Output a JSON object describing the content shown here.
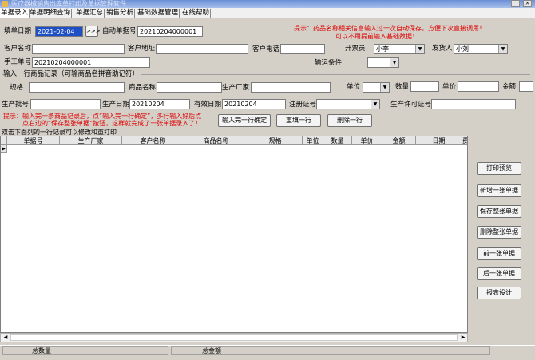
{
  "window": {
    "title": "医疗器械销售出库单打印及单据管理软件",
    "minimize": "_",
    "close": "×"
  },
  "menu": [
    {
      "label": "单据录入",
      "active": true
    },
    {
      "label": "单据明细查询",
      "active": false
    },
    {
      "label": "单据汇总",
      "active": false
    },
    {
      "label": "销售分析",
      "active": false
    },
    {
      "label": "基础数据管理",
      "active": false
    },
    {
      "label": "在线帮助",
      "active": false
    }
  ],
  "form": {
    "fill_date_label": "填单日期",
    "fill_date_value": "2021-02-04",
    "go_button": ">>>",
    "auto_no_label": "自动单据号",
    "auto_no_value": "20210204000001",
    "tip_top_line1": "提示：药品名称相关信息输入过一次自动保存，方便下次直接调用！",
    "tip_top_line2": "可以不用提前输入基础数据！",
    "customer_name_label": "客户名称",
    "customer_name_value": "",
    "customer_addr_label": "客户地址",
    "customer_addr_value": "",
    "customer_phone_label": "客户电话",
    "customer_phone_value": "",
    "issuer_label": "开票员",
    "issuer_value": "小李",
    "shipper_label": "发货人",
    "shipper_value": "小刘",
    "manual_no_label": "手工单号",
    "manual_no_value": "20210204000001",
    "transport_label": "输运条件",
    "transport_value": ""
  },
  "item": {
    "section_title": "输入一行商品记录（可输商品名拼音助记符）",
    "spec_label": "规格",
    "name_label": "商品名称",
    "maker_label": "生产厂家",
    "unit_label": "单位",
    "qty_label": "数量",
    "price_label": "单价",
    "amount_label": "金额",
    "batch_label": "生产批号",
    "prod_date_label": "生产日期",
    "prod_date_value": "20210204",
    "expiry_label": "有效日期",
    "expiry_value": "20210204",
    "reg_label": "注册证号",
    "license_label": "生产许可证号",
    "tip_line1": "提示：输入完一条商品记录后，点“输入完一行确定”，多行输入好后点",
    "tip_line2": "点右边的“保存整张单据”按钮，这样就完成了一张单据录入了！",
    "confirm_button": "输入完一行确定",
    "refill_button": "重填一行",
    "delete_row_button": "删除一行"
  },
  "grid": {
    "hint": "双击下面列的一行记录可以修改和重打印",
    "columns": [
      "单据号",
      "生产厂家",
      "客户名称",
      "商品名称",
      "规格",
      "单位",
      "数量",
      "单价",
      "金额",
      "日期",
      "费"
    ]
  },
  "side_buttons": [
    "打印预览",
    "新增一张单据",
    "保存整张单据",
    "删除整张单据",
    "前一张单据",
    "后一张单据",
    "报表设计"
  ],
  "status": {
    "total_qty_label": "总数量",
    "total_amount_label": "总金额"
  }
}
